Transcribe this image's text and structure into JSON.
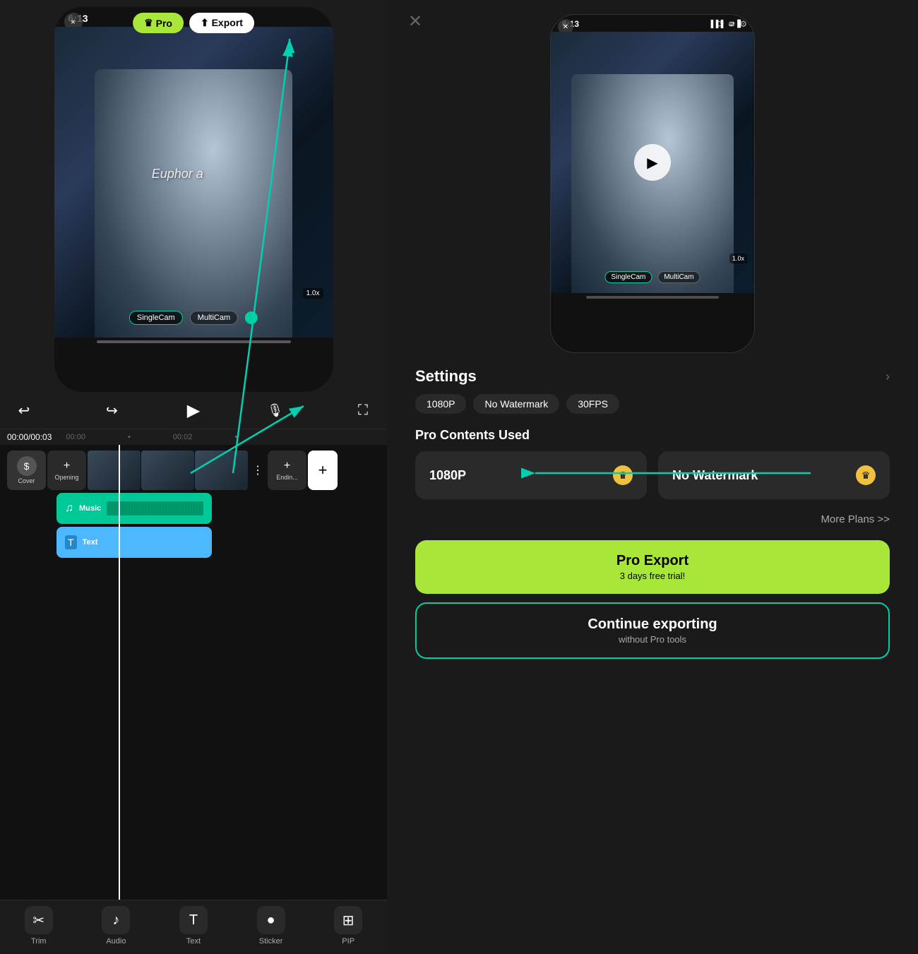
{
  "left_panel": {
    "close_btn": "×",
    "phone": {
      "time": "6:13",
      "pro_btn": "Pro",
      "export_btn": "Export",
      "export_icon": "⬆",
      "video_text": "Euphor a",
      "speed_badge": "1.0x",
      "cam_single": "SingleCam",
      "cam_multi": "MultiCam"
    },
    "controls": {
      "undo": "↩",
      "redo": "↪",
      "play": "▶",
      "voice": "🎤",
      "fullscreen": "⛶"
    },
    "timeline": {
      "current_time": "00:00",
      "total_time": "00:03",
      "marker1": "00:00",
      "marker2": "00:02",
      "cover_label": "Cover",
      "opening_label": "Opening",
      "ending_label": "Endin...",
      "music_label": "Music",
      "text_label": "Text"
    },
    "toolbar": {
      "trim_label": "Trim",
      "audio_label": "Audio",
      "text_label": "Text",
      "sticker_label": "Sticker",
      "pip_label": "PIP"
    }
  },
  "right_panel": {
    "phone": {
      "time": "6:13",
      "speed_badge": "1.0x",
      "cam_single": "SingleCam",
      "cam_multi": "MultiCam"
    },
    "settings": {
      "title": "Settings",
      "arrow": "›",
      "badge_resolution": "1080P",
      "badge_watermark": "No Watermark",
      "badge_fps": "30FPS"
    },
    "pro_contents": {
      "title": "Pro Contents Used",
      "card1_label": "1080P",
      "card2_label": "No Watermark"
    },
    "more_plans": "More Plans >>",
    "pro_export": {
      "title": "Pro Export",
      "subtitle": "3 days free trial!"
    },
    "continue": {
      "title": "Continue exporting",
      "subtitle": "without Pro tools"
    }
  },
  "arrow": {
    "color": "#00d0b0"
  }
}
